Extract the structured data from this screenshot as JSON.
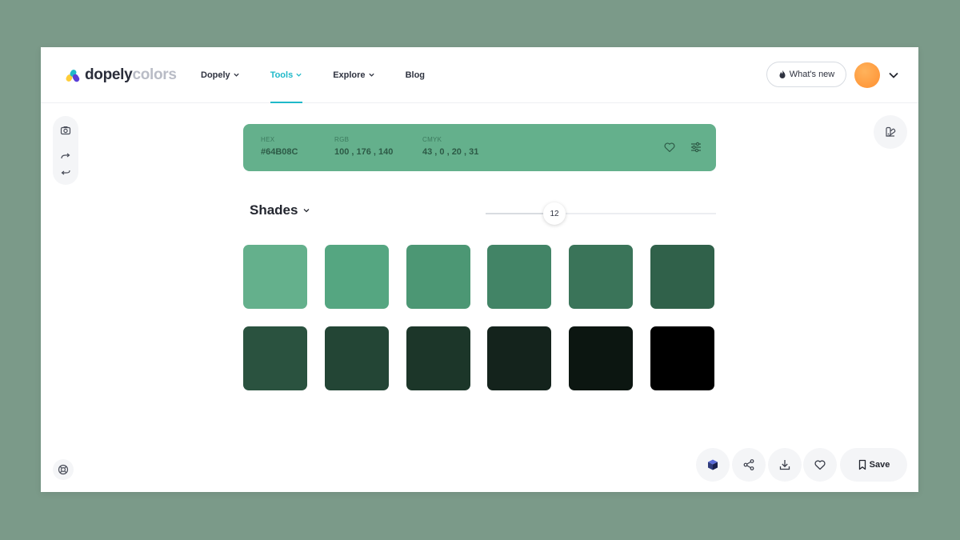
{
  "logo": {
    "part1": "dopely",
    "part2": "colors"
  },
  "nav": [
    {
      "label": "Dopely",
      "has_caret": true,
      "active": false
    },
    {
      "label": "Tools",
      "has_caret": true,
      "active": true
    },
    {
      "label": "Explore",
      "has_caret": true,
      "active": false
    },
    {
      "label": "Blog",
      "has_caret": false,
      "active": false
    }
  ],
  "header": {
    "whats_new_label": "What's new",
    "whats_new_icon": "flame-icon"
  },
  "color": {
    "hex_label": "HEX",
    "hex": "#64B08C",
    "rgb_label": "RGB",
    "rgb": "100 , 176 , 140",
    "cmyk_label": "CMYK",
    "cmyk": "43 , 0 , 20 , 31",
    "swatch_color": "#64b08c"
  },
  "shades": {
    "title": "Shades",
    "count": "12",
    "slider_fraction": 0.3,
    "swatches": [
      "#64b08c",
      "#55a681",
      "#4c9774",
      "#428466",
      "#3a7459",
      "#30614a",
      "#2a523f",
      "#234535",
      "#1c3629",
      "#14231c",
      "#0c1611",
      "#000000"
    ]
  },
  "toolbar": {
    "save_label": "Save"
  },
  "colors": {
    "accent": "#1fb9c9",
    "page_bg": "#7b9a89",
    "text_dark": "#23262f"
  }
}
